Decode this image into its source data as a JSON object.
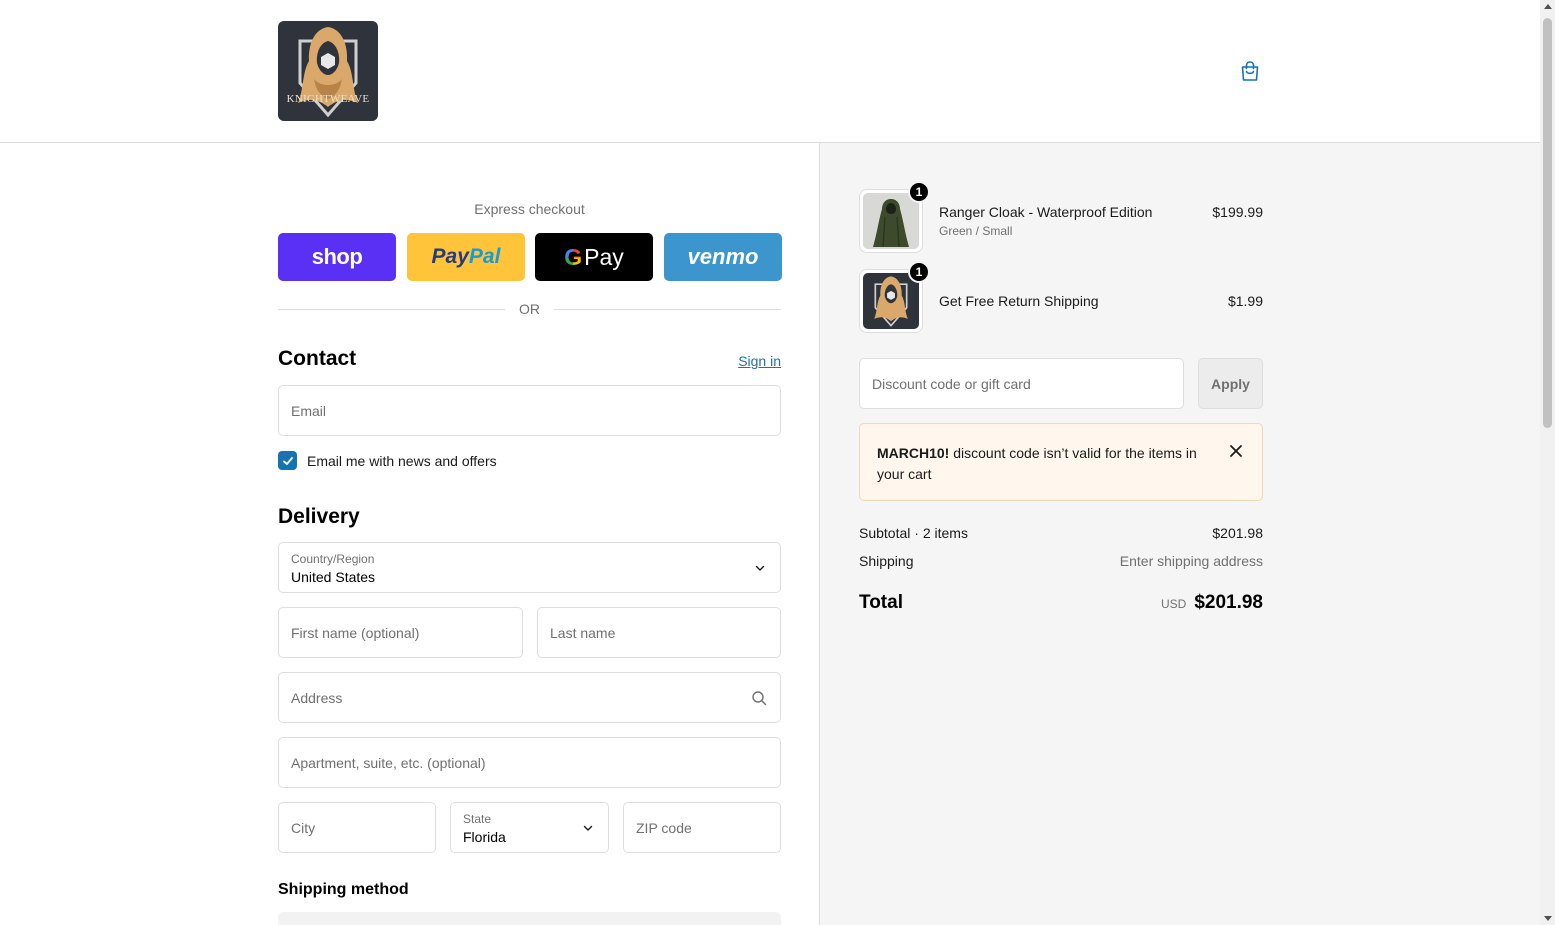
{
  "brand": {
    "logo_text": "KNIGHTWEAVE"
  },
  "header": {
    "cart_icon": "shopping-bag-icon"
  },
  "express": {
    "title": "Express checkout",
    "shop_label": "shop",
    "paypal_label_1": "Pay",
    "paypal_label_2": "Pal",
    "gpay_g": "G",
    "gpay_label": "Pay",
    "venmo_label": "venmo",
    "or_label": "OR"
  },
  "contact": {
    "heading": "Contact",
    "signin_label": "Sign in",
    "email_placeholder": "Email",
    "newsletter_label": "Email me with news and offers",
    "newsletter_checked": true
  },
  "delivery": {
    "heading": "Delivery",
    "country_label": "Country/Region",
    "country_value": "United States",
    "first_name_placeholder": "First name (optional)",
    "last_name_placeholder": "Last name",
    "address_placeholder": "Address",
    "apartment_placeholder": "Apartment, suite, etc. (optional)",
    "city_placeholder": "City",
    "state_label": "State",
    "state_value": "Florida",
    "zip_placeholder": "ZIP code"
  },
  "shipping_method": {
    "heading": "Shipping method"
  },
  "cart": {
    "items": [
      {
        "name": "Ranger Cloak - Waterproof Edition",
        "variant": "Green / Small",
        "price": "$199.99",
        "quantity": "1"
      },
      {
        "name": "Get Free Return Shipping",
        "variant": "",
        "price": "$1.99",
        "quantity": "1"
      }
    ],
    "discount_placeholder": "Discount code or gift card",
    "apply_label": "Apply",
    "alert": {
      "code": "MARCH10!",
      "message": " discount code isn’t valid for the items in your cart"
    },
    "subtotal_label": "Subtotal · 2 items",
    "subtotal_value": "$201.98",
    "shipping_label": "Shipping",
    "shipping_value": "Enter shipping address",
    "total_label": "Total",
    "total_currency": "USD",
    "total_value": "$201.98"
  },
  "colors": {
    "accent": "#1773b0",
    "shop_pay": "#5a31f4",
    "paypal": "#ffc439",
    "gpay": "#000000",
    "venmo": "#3d95ce",
    "alert_bg": "#fff7ee"
  }
}
